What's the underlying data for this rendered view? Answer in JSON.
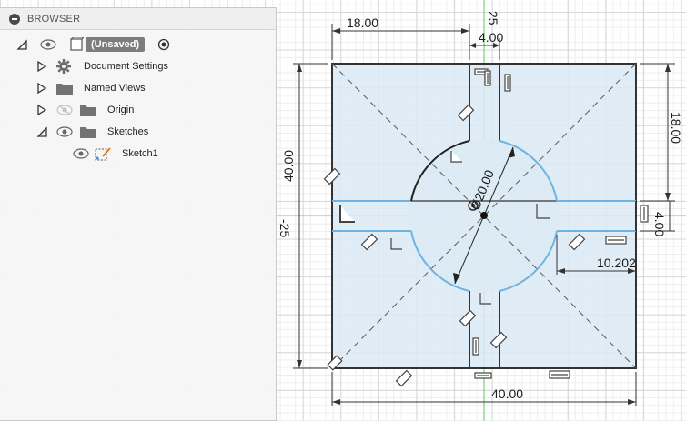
{
  "browser": {
    "title": "BROWSER",
    "root_label": "(Unsaved)",
    "items": [
      {
        "label": "Document Settings"
      },
      {
        "label": "Named Views"
      },
      {
        "label": "Origin"
      },
      {
        "label": "Sketches"
      },
      {
        "label": "Sketch1"
      }
    ]
  },
  "dimensions": {
    "top_width": "18.00",
    "slot_width": "4.00",
    "right_height": "18.00",
    "left_height": "40.00",
    "diameter": "Ø20.00",
    "right_small": "4.00",
    "offset": "10.202",
    "bottom_width": "40.00",
    "axis_top": "25",
    "axis_left": "-25"
  },
  "colors": {
    "profile_fill": "#dceaf5",
    "curve": "#6fb3e0",
    "origin_axis": "#ee8888",
    "vertical_axis": "#66cc66"
  }
}
